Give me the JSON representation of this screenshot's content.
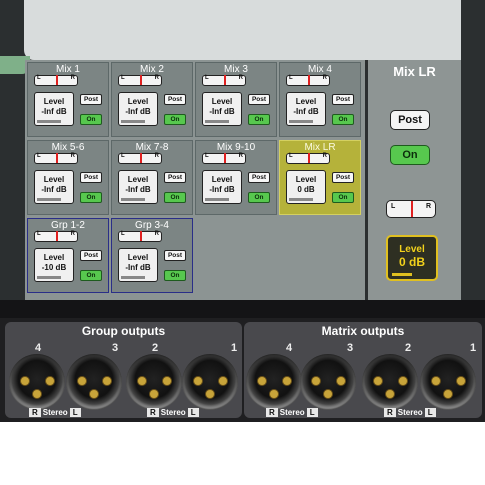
{
  "mix_panel": {
    "cells": [
      {
        "title": "Mix 1",
        "level_label": "Level",
        "level_value": "-Inf dB",
        "post_label": "Post",
        "on_label": "On",
        "bal_l": "L",
        "bal_r": "R"
      },
      {
        "title": "Mix 2",
        "level_label": "Level",
        "level_value": "-Inf dB",
        "post_label": "Post",
        "on_label": "On",
        "bal_l": "L",
        "bal_r": "R"
      },
      {
        "title": "Mix 3",
        "level_label": "Level",
        "level_value": "-Inf dB",
        "post_label": "Post",
        "on_label": "On",
        "bal_l": "L",
        "bal_r": "R"
      },
      {
        "title": "Mix 4",
        "level_label": "Level",
        "level_value": "-Inf dB",
        "post_label": "Post",
        "on_label": "On",
        "bal_l": "L",
        "bal_r": "R"
      },
      {
        "title": "Mix 5-6",
        "level_label": "Level",
        "level_value": "-Inf dB",
        "post_label": "Post",
        "on_label": "On",
        "bal_l": "L",
        "bal_r": "R"
      },
      {
        "title": "Mix 7-8",
        "level_label": "Level",
        "level_value": "-Inf dB",
        "post_label": "Post",
        "on_label": "On",
        "bal_l": "L",
        "bal_r": "R"
      },
      {
        "title": "Mix 9-10",
        "level_label": "Level",
        "level_value": "-Inf dB",
        "post_label": "Post",
        "on_label": "On",
        "bal_l": "L",
        "bal_r": "R"
      },
      {
        "title": "Mix LR",
        "level_label": "Level",
        "level_value": "0 dB",
        "post_label": "Post",
        "on_label": "On",
        "bal_l": "L",
        "bal_r": "R"
      },
      {
        "title": "Grp 1-2",
        "level_label": "Level",
        "level_value": "-10 dB",
        "post_label": "Post",
        "on_label": "On",
        "bal_l": "L",
        "bal_r": "R"
      },
      {
        "title": "Grp 3-4",
        "level_label": "Level",
        "level_value": "-Inf dB",
        "post_label": "Post",
        "on_label": "On",
        "bal_l": "L",
        "bal_r": "R"
      }
    ]
  },
  "side_panel": {
    "title": "Mix LR",
    "post_label": "Post",
    "on_label": "On",
    "bal_l": "L",
    "bal_r": "R",
    "level_label": "Level",
    "level_value": "0 dB"
  },
  "hardware": {
    "group_label": "Group outputs",
    "matrix_label": "Matrix outputs",
    "numbers": [
      "4",
      "3",
      "2",
      "1"
    ],
    "sub_r": "R",
    "sub_stereo": "Stereo",
    "sub_l": "L"
  },
  "colors": {
    "on_green": "#57c84e",
    "mix_lr_highlight": "#b5b23a",
    "level_yellow": "#f2d21c"
  }
}
